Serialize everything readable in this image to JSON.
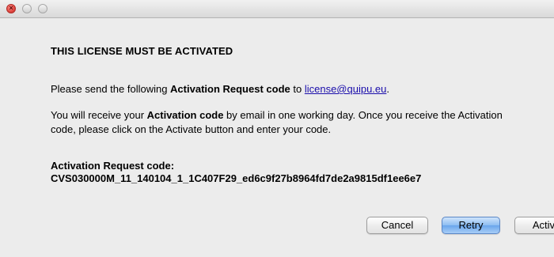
{
  "dialog": {
    "heading": "THIS LICENSE MUST BE ACTIVATED",
    "send_prefix": "Please send the following ",
    "send_bold": "Activation Request code",
    "send_mid": " to ",
    "email": "license@quipu.eu",
    "send_suffix": ".",
    "info_prefix": "You will receive your ",
    "info_bold": "Activation code",
    "info_suffix": " by email in one working day. Once you receive the Activation code, please click on the Activate button and enter your code.",
    "code_label": "Activation Request code:",
    "code_value": "CVS030000M_11_140104_1_1C407F29_ed6c9f27b8964fd7de2a9815df1ee6e7"
  },
  "buttons": {
    "cancel": "Cancel",
    "retry": "Retry",
    "activate": "Activate"
  },
  "icons": {
    "close": "close-icon",
    "minimize": "minimize-icon",
    "maximize": "maximize-icon"
  },
  "colors": {
    "link": "#1a0dab",
    "default_button": "#6aa6ec",
    "close_button": "#e0443e"
  }
}
